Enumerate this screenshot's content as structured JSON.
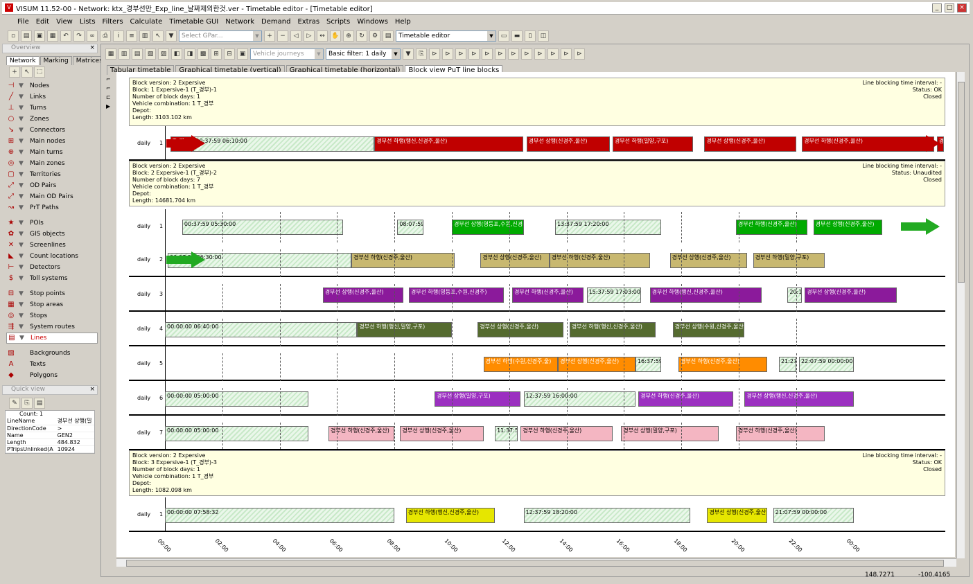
{
  "window": {
    "title": "VISUM 11.52-00 - Network: ktx_경부선만_Exp_line_날짜제외한것.ver - Timetable editor - [Timetable editor]"
  },
  "menu": [
    "File",
    "Edit",
    "View",
    "Lists",
    "Filters",
    "Calculate",
    "Timetable GUI",
    "Network",
    "Demand",
    "Extras",
    "Scripts",
    "Windows",
    "Help"
  ],
  "toolbar": {
    "gpar_placeholder": "Select GPar...",
    "view_combo": "Timetable editor",
    "vj_combo": "Vehicle journeys",
    "filter_combo": "Basic filter: 1 daily"
  },
  "overview": {
    "title": "Overview",
    "tabs": [
      "Network",
      "Marking",
      "Matrices"
    ],
    "items": [
      "Nodes",
      "Links",
      "Turns",
      "Zones",
      "Connectors",
      "Main nodes",
      "Main turns",
      "Main zones",
      "Territories",
      "OD Pairs",
      "Main OD Pairs",
      "PrT Paths",
      "POIs",
      "GIS objects",
      "Screenlines",
      "Count locations",
      "Detectors",
      "Toll systems",
      "Stop points",
      "Stop areas",
      "Stops",
      "System routes",
      "Lines",
      "Backgrounds",
      "Texts",
      "Polygons"
    ]
  },
  "quickview": {
    "title": "Quick view",
    "count": "Count: 1",
    "rows": [
      [
        "LineName",
        "경부선 상행(밀"
      ],
      [
        "DirectionCode",
        ">"
      ],
      [
        "Name",
        "GEN2"
      ],
      [
        "Length",
        "484.832"
      ],
      [
        "PTripsUnlinked(A",
        "10924"
      ]
    ]
  },
  "tabs": [
    "Tabular timetable",
    "Graphical timetable (vertical)",
    "Graphical timetable (horizontal)",
    "Block view PuT line blocks"
  ],
  "blocks": [
    {
      "lines": [
        "Block version: 2 Expersive",
        "Block: 1 Expersive-1 (T_경부)-1",
        "Number of block days: 1",
        "Vehicle combination: 1 T_경부",
        "Depot:",
        "Length: 3103.102 km"
      ],
      "right": [
        "Line blocking time interval: -",
        "Status: OK",
        "Closed"
      ]
    },
    {
      "lines": [
        "Block version: 2 Expersive",
        "Block: 2 Expersive-1 (T_경부)-2",
        "Number of block days: 7",
        "Vehicle combination: 1 T_경부",
        "Depot:",
        "Length: 14681.704 km"
      ],
      "right": [
        "Line blocking time interval: -",
        "Status: Unaudited",
        "Closed"
      ]
    },
    {
      "lines": [
        "Block version: 2 Expersive",
        "Block: 3 Expersive-1 (T_경부)-3",
        "Number of block days: 1",
        "Vehicle combination: 1 T_경부",
        "Depot:",
        "Length: 1082.098 km"
      ],
      "right": [
        "Line blocking time interval: -",
        "Status: OK",
        "Closed"
      ]
    }
  ],
  "rows": [
    {
      "day": "daily",
      "num": "1",
      "color": "#c00000",
      "arrowL": true,
      "arrowR": true,
      "bars": [
        [
          "T_경",
          "",
          "#c00000"
        ],
        [
          "00:37:59 06:10:00",
          "",
          "hatch"
        ],
        [
          "경부선 하행(행신,신경주,울산)",
          "",
          "#c00000"
        ],
        [
          "경부선 상행(신경주,울산)",
          "",
          "#c00000"
        ],
        [
          "경부선 하행(밀양,구포)",
          "",
          "#c00000"
        ],
        [
          "경부선 상행(신경주,울산)",
          "",
          "#c00000"
        ],
        [
          "경부선 하행(신경주,울산)",
          "",
          "#c00000"
        ],
        [
          "경부선 상행(신경주",
          "",
          "#c00000"
        ]
      ],
      "labels": [
        "경부선",
        "37",
        "22:00:00",
        "경부선",
        "경부선 경부선",
        "47",
        "경부선",
        "37",
        "경부선",
        "39",
        "경부선",
        "27",
        "경부선",
        "59",
        "경부선",
        "00:37:59"
      ]
    },
    {
      "day": "daily",
      "num": "1",
      "color": "#00aa00",
      "bars": [
        [
          "00:37:59 05:30:00",
          "hatch"
        ],
        [
          "08:07:59 09:00:00",
          "hatch"
        ],
        [
          "경부선 상행(영등포,수원,신경주)",
          "#00aa00"
        ],
        [
          "13:37:59 17:20:00",
          "hatch"
        ],
        [
          "경부선 하행(신경주,울산)",
          "#00aa00"
        ],
        [
          "경부선 상행(신경주,울산)",
          "#00aa00"
        ]
      ]
    },
    {
      "day": "daily",
      "num": "2",
      "color": "#bdb76b",
      "bars": [
        [
          "00:07:59 06:30:00",
          "hatch"
        ],
        [
          "경부선 하행(신경주,울산)",
          "#c8b870"
        ],
        [
          "경부선 상행(신경주,울산)",
          "#c8b870"
        ],
        [
          "경부선 하행(신경주,울산)",
          "#c8b870"
        ],
        [
          "경부선 상행(신경주,울산)",
          "#c8b870"
        ],
        [
          "경부선 하행(밀양,구포)",
          "#c8b870"
        ]
      ]
    },
    {
      "day": "daily",
      "num": "3",
      "color": "#8b1a9b",
      "bars": [
        [
          "경부선 상행(신경주,울산)",
          "#8b1a9b"
        ],
        [
          "경부선 하행(영등포,수원,신경주)",
          "#8b1a9b"
        ],
        [
          "경부선 하행(신경주,울산)",
          "#8b1a9b"
        ],
        [
          "15:37:59 17:03:00",
          "hatch"
        ],
        [
          "경부선 하행(행신,신경주,울산)",
          "#8b1a9b"
        ],
        [
          "20:17:59 21:00:00",
          "hatch"
        ],
        [
          "경부선 상행(신경주,울산)",
          "#8b1a9b"
        ]
      ]
    },
    {
      "day": "daily",
      "num": "4",
      "color": "#4b5a1e",
      "bars": [
        [
          "00:00:00 06:40:00",
          "hatch"
        ],
        [
          "경부선 하행(행신,밀양,구포)",
          "#556b2f"
        ],
        [
          "경부선 상행(신경주,울산)",
          "#556b2f"
        ],
        [
          "경부선 하행(행신,신경주,울산)",
          "#556b2f"
        ],
        [
          "경부선 상행(수원,신경주,울산)",
          "#556b2f"
        ]
      ]
    },
    {
      "day": "daily",
      "num": "5",
      "color": "#ff8c00",
      "bars": [
        [
          "경부선 하행(수원,신경주,울)",
          "#ff8c00"
        ],
        [
          "경부선 상행(신경주,울산)",
          "#ff8c00"
        ],
        [
          "16:37:59 17:30:00",
          "hatch"
        ],
        [
          "경부선 하행(신경주,울산)",
          "#ff8c00"
        ],
        [
          "21:27 22:00",
          "hatch"
        ],
        [
          "22:07:59 00:00:00",
          "hatch"
        ]
      ]
    },
    {
      "day": "daily",
      "num": "6",
      "color": "#9b30c0",
      "bars": [
        [
          "00:00:00 05:00:00",
          "hatch"
        ],
        [
          "경부선 상행(밀양,구포)",
          "#9b30c0"
        ],
        [
          "12:37:59 16:00:00",
          "hatch"
        ],
        [
          "경부선 하행(신경주,울산)",
          "#9b30c0"
        ],
        [
          "경부선 상행(행신,신경주,울산)",
          "#9b30c0"
        ],
        [
          "23:07:59 00:00:00",
          "hatch"
        ]
      ]
    },
    {
      "day": "daily",
      "num": "7",
      "color": "#f4b6c2",
      "bars": [
        [
          "00:00:00 05:00:00",
          "hatch"
        ],
        [
          "경부선 하행(신경주,울산)",
          "#f4b6c2"
        ],
        [
          "경부선 상행(신경주,울산)",
          "#f4b6c2"
        ],
        [
          "11:37:59 12:30:00",
          "hatch"
        ],
        [
          "경부선 하행(신경주,울산)",
          "#f4b6c2"
        ],
        [
          "경부선 상행(밀양,구포)",
          "#f4b6c2"
        ],
        [
          "경부선 하행(신경주,울산)",
          "#f4b6c2"
        ]
      ]
    },
    {
      "day": "daily",
      "num": "1",
      "color": "#e0e000",
      "bars": [
        [
          "00:00:00 07:58:32",
          "hatch"
        ],
        [
          "경부선 하행(행신,신경주,울산)",
          "#e6e600"
        ],
        [
          "12:37:59 18:20:00",
          "hatch"
        ],
        [
          "경부선 상행(신경주,울산)",
          "#e6e600"
        ],
        [
          "21:07:59 00:00:00",
          "hatch"
        ]
      ]
    }
  ],
  "axis": [
    "00:00",
    "02:00",
    "04:00",
    "06:00",
    "08:00",
    "10:00",
    "12:00",
    "14:00",
    "16:00",
    "18:00",
    "20:00",
    "22:00",
    "00:00"
  ],
  "status": {
    "x": "148.7271",
    "y": "-100.4165"
  }
}
